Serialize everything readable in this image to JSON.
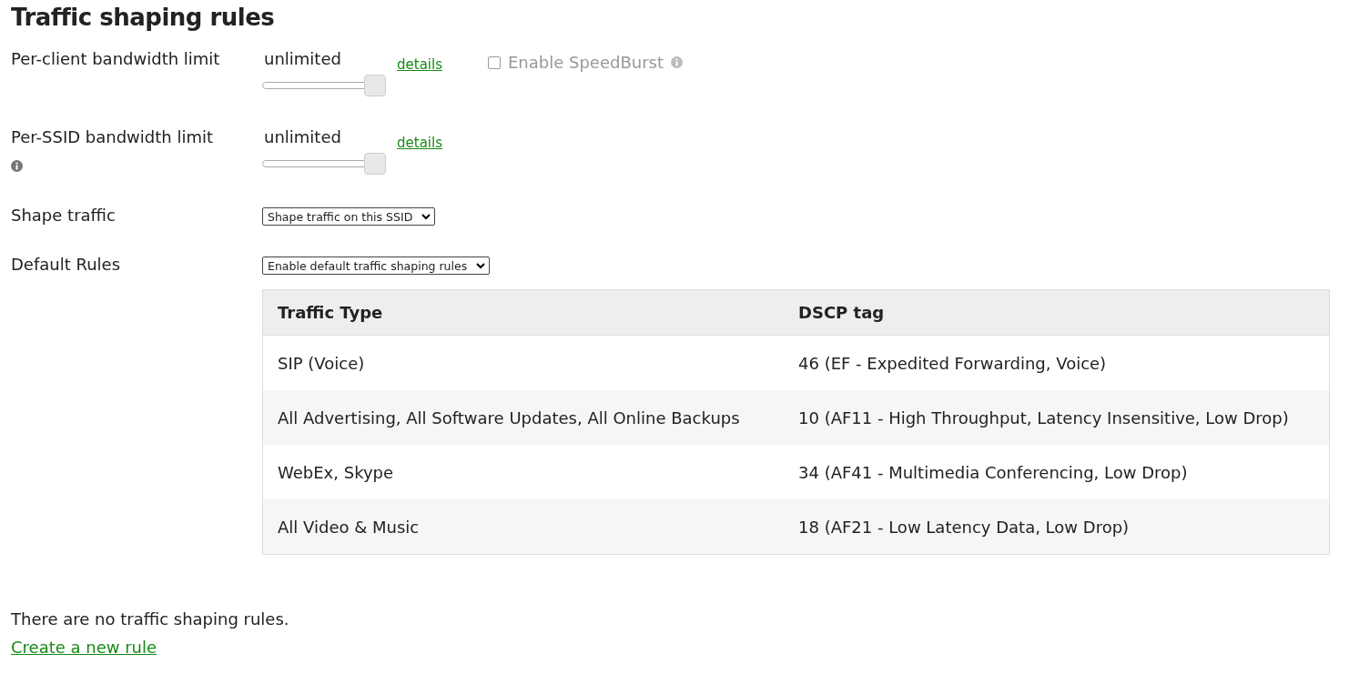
{
  "title": "Traffic shaping rules",
  "bandwidth_rows": [
    {
      "label": "Per-client bandwidth limit",
      "info": false,
      "reading": "unlimited",
      "level": 1,
      "details": "details",
      "speedburst": {
        "label": "Enable SpeedBurst",
        "checked": false,
        "disabled": true
      }
    },
    {
      "label": "Per-SSID bandwidth limit",
      "info": true,
      "reading": "unlimited",
      "level": 1,
      "details": "details"
    }
  ],
  "select_rows": [
    {
      "label": "Shape traffic",
      "value": "Shape traffic on this SSID"
    },
    {
      "label": "Default Rules",
      "value": "Enable default traffic shaping rules"
    }
  ],
  "table": {
    "columns": [
      "Traffic Type",
      "DSCP tag"
    ],
    "rows": [
      [
        "SIP (Voice)",
        "46 (EF - Expedited Forwarding, Voice)"
      ],
      [
        "All Advertising, All Software Updates, All Online Backups",
        "10 (AF11 - High Throughput, Latency Insensitive, Low Drop)"
      ],
      [
        "WebEx, Skype",
        "34 (AF41 - Multimedia Conferencing, Low Drop)"
      ],
      [
        "All Video & Music",
        "18 (AF21 - Low Latency Data, Low Drop)"
      ]
    ]
  },
  "empty_message": "There are no traffic shaping rules.",
  "create_link": "Create a new rule"
}
